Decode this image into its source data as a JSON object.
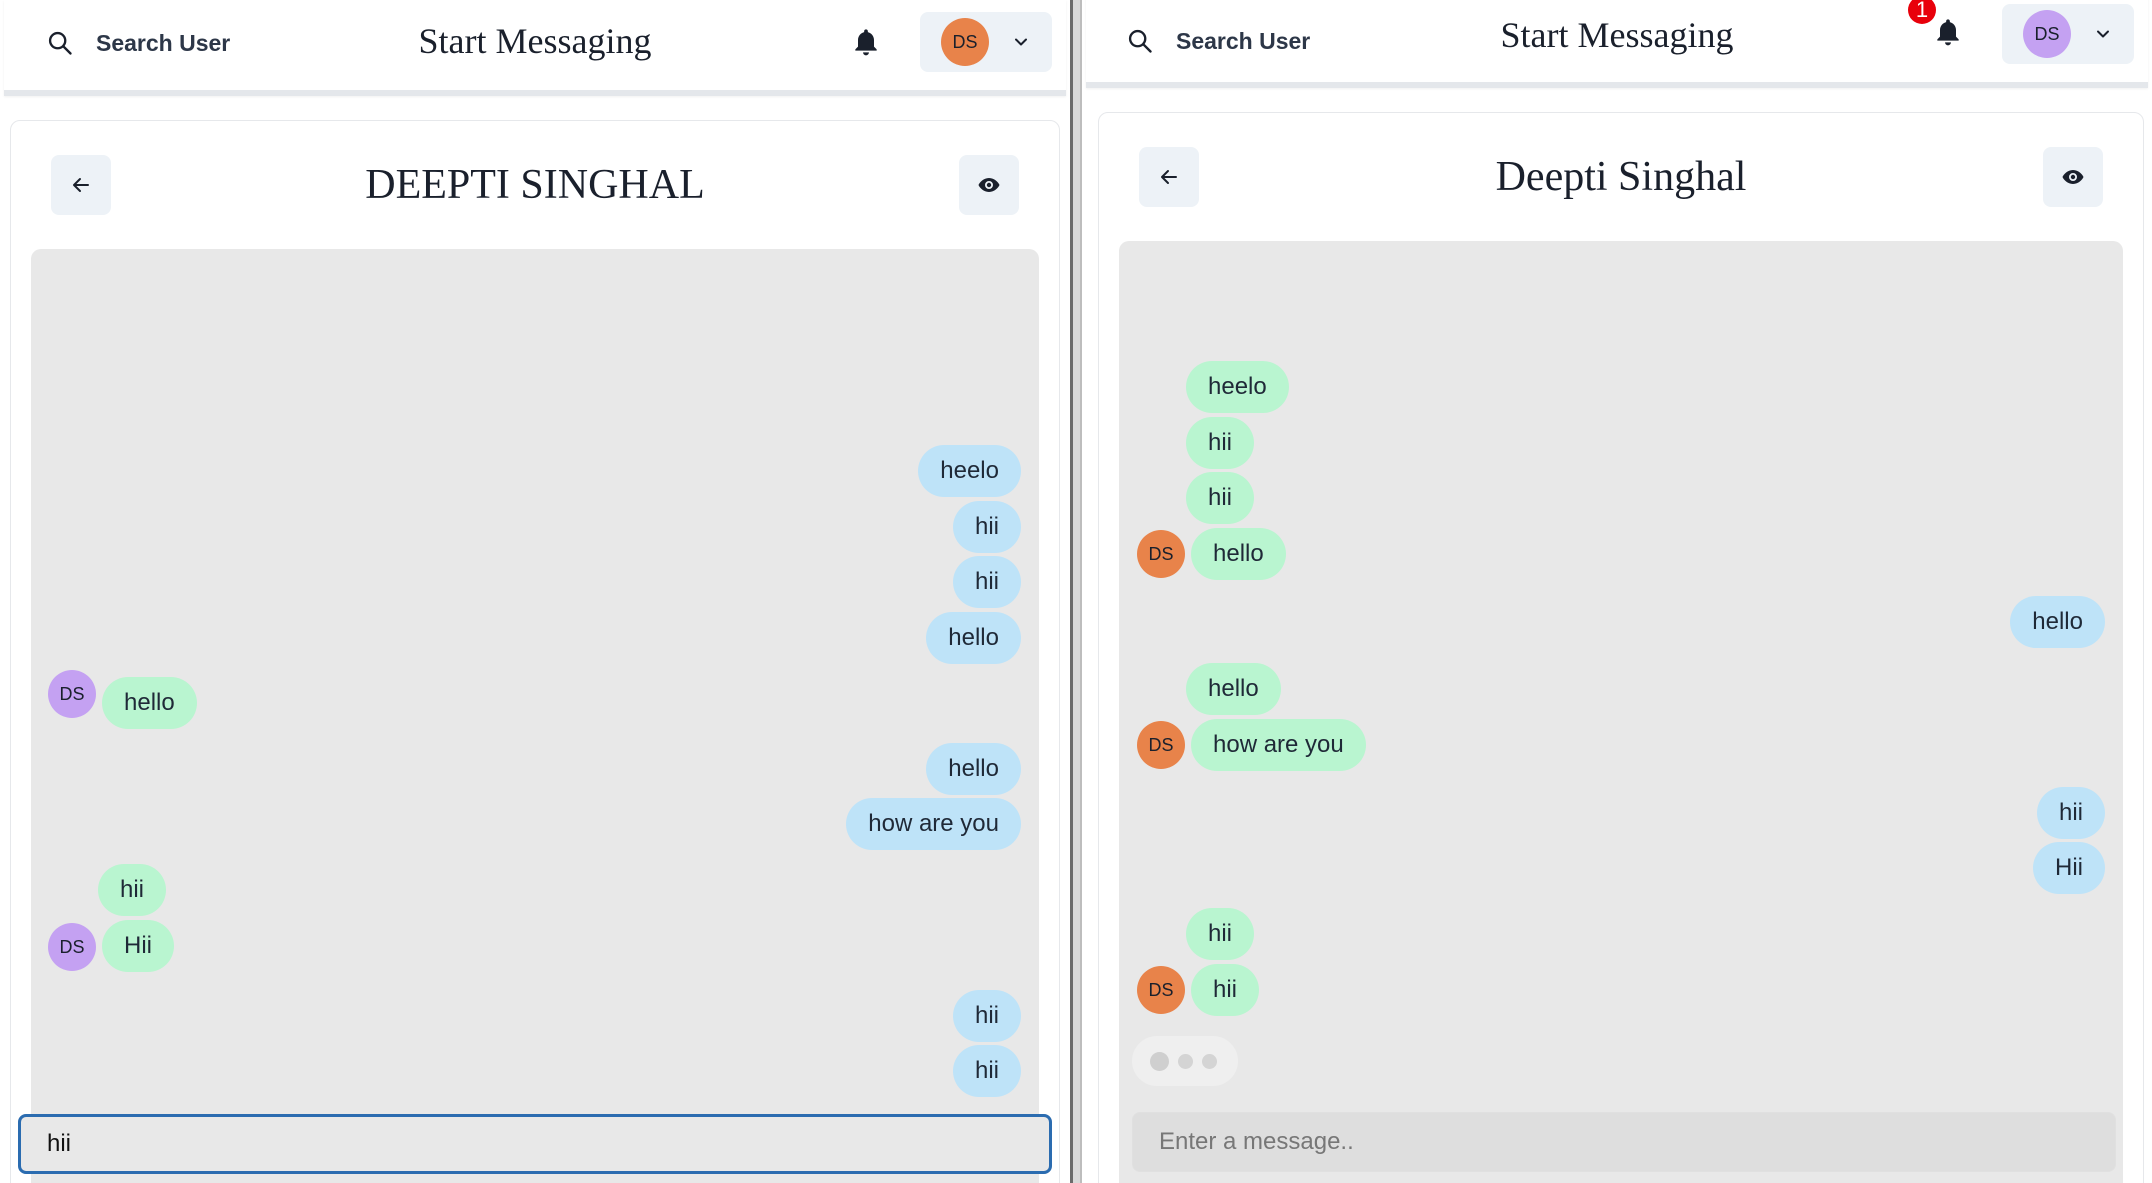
{
  "colors": {
    "orange_avatar": "#e8834a",
    "purple_avatar": "#c4a1f2",
    "my_bubble": "#bee3f8",
    "their_bubble": "#b9f5d0",
    "input_focus": "#2b6cb0",
    "badge_red": "#e8000b"
  },
  "left": {
    "search_label": "Search User",
    "app_title": "Start Messaging",
    "profile_initials": "DS",
    "chat_name": "DEEPTI SINGHAL",
    "messages": {
      "m1": "heelo",
      "m2": "hii",
      "m3": "hii",
      "m4": "hello",
      "m5": "hello",
      "m5_avatar": "DS",
      "m6": "hello",
      "m7": "how are you",
      "m8": "hii",
      "m9": "Hii",
      "m9_avatar": "DS",
      "m10": "hii",
      "m11": "hii"
    },
    "input_value": "hii"
  },
  "right": {
    "search_label": "Search User",
    "app_title": "Start Messaging",
    "notification_count": "1",
    "profile_initials": "DS",
    "chat_name": "Deepti Singhal",
    "messages": {
      "m1": "heelo",
      "m2": "hii",
      "m3": "hii",
      "m4": "hello",
      "m4_avatar": "DS",
      "m5": "hello",
      "m6": "hello",
      "m7": "how are you",
      "m7_avatar": "DS",
      "m8": "hii",
      "m9": "Hii",
      "m10": "hii",
      "m11": "hii",
      "m11_avatar": "DS"
    },
    "input_placeholder": "Enter a message.."
  }
}
